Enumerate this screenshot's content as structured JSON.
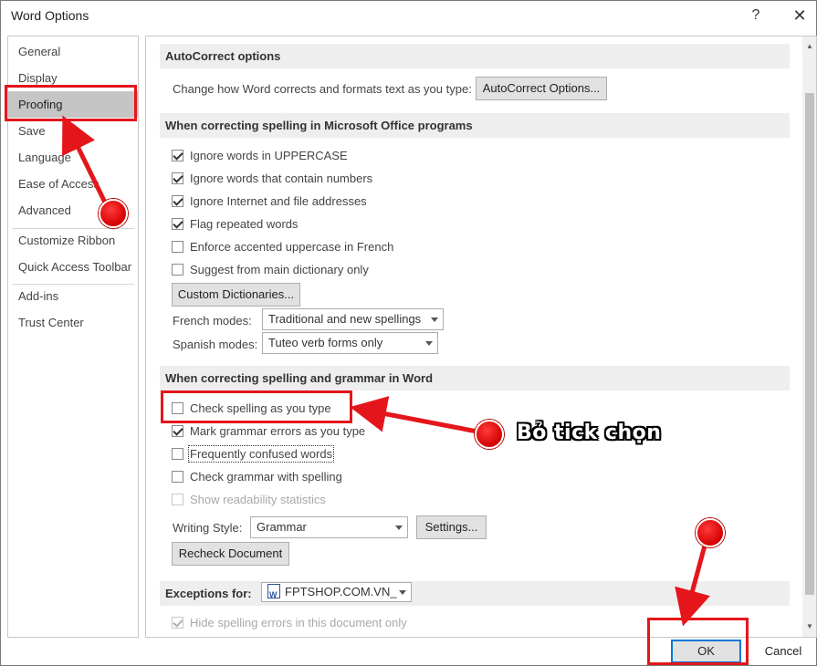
{
  "window": {
    "title": "Word Options",
    "help_label": "?",
    "close_label": "✕"
  },
  "sidebar": {
    "items": [
      {
        "label": "General"
      },
      {
        "label": "Display"
      },
      {
        "label": "Proofing",
        "selected": true
      },
      {
        "label": "Save"
      },
      {
        "label": "Language"
      },
      {
        "label": "Ease of Access"
      },
      {
        "label": "Advanced"
      },
      {
        "label": "Customize Ribbon"
      },
      {
        "label": "Quick Access Toolbar"
      },
      {
        "label": "Add-ins"
      },
      {
        "label": "Trust Center"
      }
    ]
  },
  "autocorrect": {
    "heading": "AutoCorrect options",
    "description": "Change how Word corrects and formats text as you type:",
    "button_label": "AutoCorrect Options..."
  },
  "spelling_office": {
    "heading": "When correcting spelling in Microsoft Office programs",
    "options": [
      {
        "label": "Ignore words in UPPERCASE",
        "checked": true
      },
      {
        "label": "Ignore words that contain numbers",
        "checked": true
      },
      {
        "label": "Ignore Internet and file addresses",
        "checked": true
      },
      {
        "label": "Flag repeated words",
        "checked": true
      },
      {
        "label": "Enforce accented uppercase in French",
        "checked": false
      },
      {
        "label": "Suggest from main dictionary only",
        "checked": false
      }
    ],
    "custom_dictionaries_label": "Custom Dictionaries...",
    "french_modes_label": "French modes:",
    "french_modes_value": "Traditional and new spellings",
    "spanish_modes_label": "Spanish modes:",
    "spanish_modes_value": "Tuteo verb forms only"
  },
  "spelling_word": {
    "heading": "When correcting spelling and grammar in Word",
    "options": [
      {
        "label": "Check spelling as you type",
        "checked": false
      },
      {
        "label": "Mark grammar errors as you type",
        "checked": true
      },
      {
        "label": "Frequently confused words",
        "checked": false
      },
      {
        "label": "Check grammar with spelling",
        "checked": false
      },
      {
        "label": "Show readability statistics",
        "checked": false,
        "disabled": true
      }
    ],
    "writing_style_label": "Writing Style:",
    "writing_style_value": "Grammar",
    "settings_label": "Settings...",
    "recheck_label": "Recheck Document"
  },
  "exceptions": {
    "heading": "Exceptions for:",
    "document_value": "FPTSHOP.COM.VN_",
    "hide_spelling_label": "Hide spelling errors in this document only",
    "hide_spelling_checked": true
  },
  "footer": {
    "ok_label": "OK",
    "cancel_label": "Cancel"
  },
  "annotations": {
    "callout_text": "Bỏ tick chọn",
    "color": "#e4161b"
  }
}
